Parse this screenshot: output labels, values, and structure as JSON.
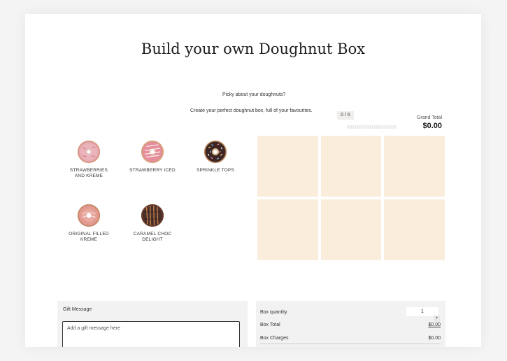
{
  "page": {
    "title": "Build your own Doughnut Box",
    "intro_question": "Picky about your doughnuts?",
    "intro_text": "Create your perfect doughnut box, full of your favourites."
  },
  "progress": {
    "count_label": "0 / 6",
    "filled": 0,
    "capacity": 6
  },
  "total": {
    "label": "Grand Total",
    "value": "$0.00"
  },
  "products": [
    {
      "name": "STRAWBERRIES AND KREME",
      "icon": "strawberry-kreme-doughnut-icon"
    },
    {
      "name": "STRAWBERRY ICED",
      "icon": "strawberry-iced-doughnut-icon"
    },
    {
      "name": "SPRINKLE TOPS",
      "icon": "sprinkle-tops-doughnut-icon"
    },
    {
      "name": "ORIGINAL FILLED KREME",
      "icon": "original-filled-kreme-doughnut-icon"
    },
    {
      "name": "CARAMEL CHOC DELIGHT",
      "icon": "caramel-choc-delight-doughnut-icon"
    }
  ],
  "box": {
    "slots": 6,
    "slot_color": "#faeddb"
  },
  "gift": {
    "label": "Gift Message",
    "placeholder": "Add a gift message here"
  },
  "summary": {
    "quantity_label": "Box quantity",
    "quantity_value": "1",
    "stepper_symbol": "+",
    "box_total_label": "Box Total",
    "box_total_value": "$0.00",
    "box_charges_label": "Box Charges",
    "box_charges_value": "$0.00"
  },
  "colors": {
    "pink_glaze": "#e7a9b3",
    "chocolate": "#4a2e2a",
    "panel_bg": "#f2f2f2"
  }
}
